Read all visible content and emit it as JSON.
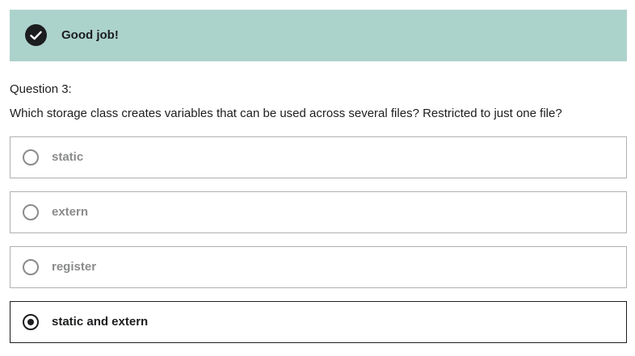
{
  "feedback": {
    "message": "Good job!",
    "icon": "checkmark-icon",
    "background_color": "#acd2cc"
  },
  "question": {
    "label": "Question 3:",
    "text": "Which storage class creates variables that can be used across several files? Restricted to just one file?"
  },
  "answers": [
    {
      "label": "static",
      "selected": false
    },
    {
      "label": "extern",
      "selected": false
    },
    {
      "label": "register",
      "selected": false
    },
    {
      "label": "static and extern",
      "selected": true
    }
  ],
  "colors": {
    "text": "#1c1d1f",
    "muted_text": "#8a8b8c",
    "border": "#b0b0b0"
  }
}
